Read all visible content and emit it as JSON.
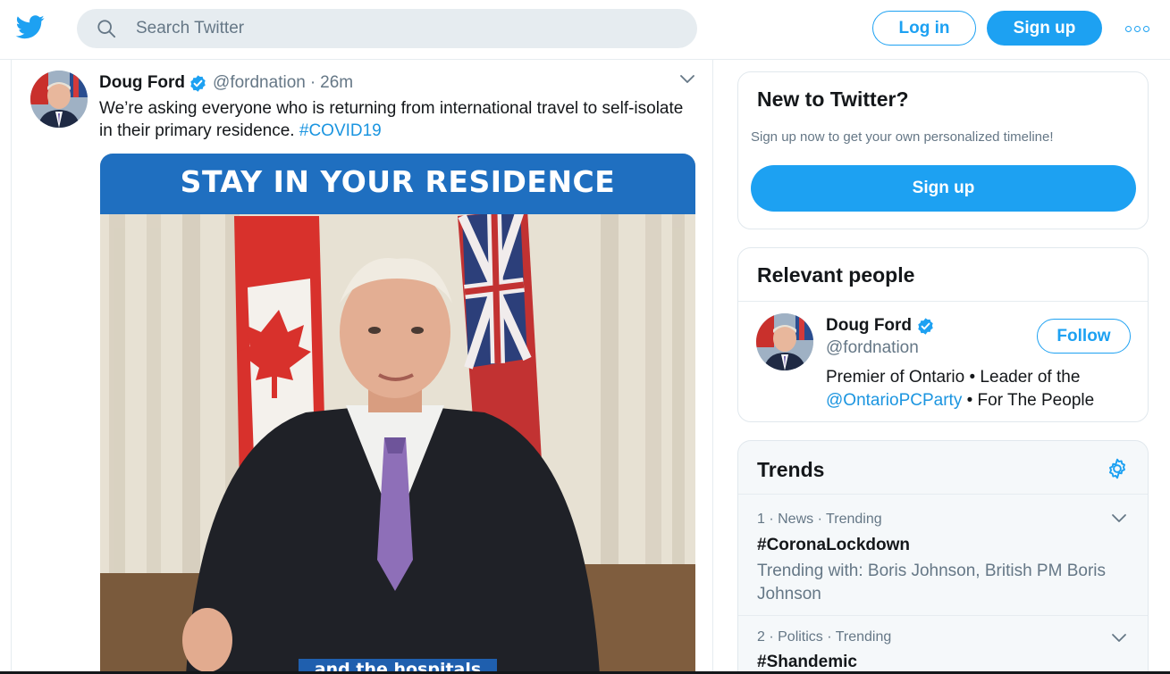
{
  "header": {
    "search_placeholder": "Search Twitter",
    "login_label": "Log in",
    "signup_label": "Sign up",
    "more_icon": "more-dots-icon",
    "brand_color": "#1da1f2"
  },
  "tweet": {
    "name": "Doug Ford",
    "handle": "@fordnation",
    "separator": "·",
    "time": "26m",
    "text": "We’re asking everyone who is returning from international travel to self-isolate in their primary residence.",
    "hashtag": "#COVID19",
    "media": {
      "banner_text": "STAY IN YOUR RESIDENCE",
      "caption_text": "and the hospitals"
    }
  },
  "new_to_twitter": {
    "title": "New to Twitter?",
    "subtitle": "Sign up now to get your own personalized timeline!",
    "button_label": "Sign up"
  },
  "relevant_people": {
    "title": "Relevant people",
    "person": {
      "name": "Doug Ford",
      "handle": "@fordnation",
      "bio_part1": "Premier of Ontario • Leader of the",
      "bio_link": "@OntarioPCParty",
      "bio_part2": " • For The People",
      "follow_label": "Follow"
    }
  },
  "trends": {
    "title": "Trends",
    "items": [
      {
        "meta": "1 · News · Trending",
        "tag": "#CoronaLockdown",
        "with": "Trending with: Boris Johnson, British PM Boris Johnson"
      },
      {
        "meta": "2 · Politics · Trending",
        "tag": "#Shandemic",
        "with": ""
      }
    ]
  }
}
